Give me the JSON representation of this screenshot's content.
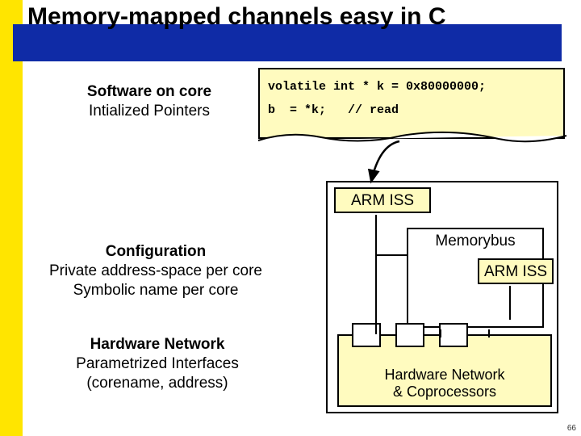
{
  "title": "Memory-mapped channels easy in C",
  "left": {
    "software_heading": "Software on core",
    "software_sub": "Intialized Pointers",
    "config_heading": "Configuration",
    "config_line1": "Private address-space per core",
    "config_line2": "Symbolic name per core",
    "hw_heading": "Hardware Network",
    "hw_line1": "Parametrized Interfaces",
    "hw_line2": "(corename, address)"
  },
  "code": {
    "line1": "volatile int * k = 0x80000000;",
    "line2": "b  = *k;   // read"
  },
  "diagram": {
    "arm_iss": "ARM ISS",
    "memorybus": "Memorybus",
    "hw_coproc_l1": "Hardware Network",
    "hw_coproc_l2": "& Coprocessors"
  },
  "page_number": "66"
}
